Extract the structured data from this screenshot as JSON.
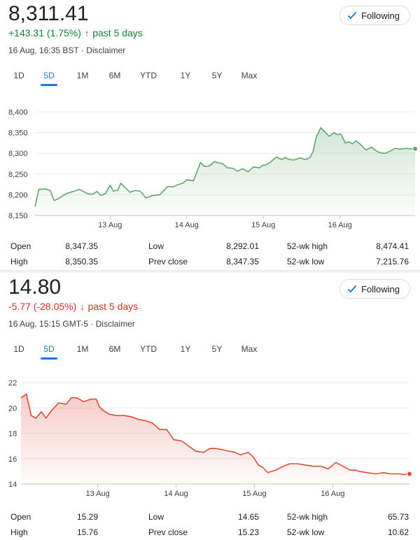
{
  "cards": [
    {
      "price": "8,311.41",
      "change_text": "+143.31 (1.75%)",
      "change_arrow": "↑",
      "change_period": "past 5 days",
      "timestamp": "16 Aug, 16:35 BST · Disclaimer",
      "trend": "up",
      "follow_label": "Following",
      "tabs": [
        "1D",
        "5D",
        "1M",
        "6M",
        "YTD",
        "1Y",
        "5Y",
        "Max"
      ],
      "active_tab": "5D",
      "stats": {
        "open": {
          "label": "Open",
          "value": "8,347.35"
        },
        "high": {
          "label": "High",
          "value": "8,350.35"
        },
        "low": {
          "label": "Low",
          "value": "8,292.01"
        },
        "prev_close": {
          "label": "Prev close",
          "value": "8,347.35"
        },
        "wk52_high": {
          "label": "52-wk high",
          "value": "8,474.41"
        },
        "wk52_low": {
          "label": "52-wk low",
          "value": "7,215.76"
        }
      }
    },
    {
      "price": "14.80",
      "change_text": "-5.77 (-28.05%)",
      "change_arrow": "↓",
      "change_period": "past 5 days",
      "timestamp": "16 Aug, 15:15 GMT-5 · Disclaimer",
      "trend": "down",
      "follow_label": "Following",
      "tabs": [
        "1D",
        "5D",
        "1M",
        "6M",
        "YTD",
        "1Y",
        "5Y",
        "Max"
      ],
      "active_tab": "5D",
      "stats": {
        "open": {
          "label": "Open",
          "value": "15.29"
        },
        "high": {
          "label": "High",
          "value": "15.76"
        },
        "low": {
          "label": "Low",
          "value": "14.65"
        },
        "prev_close": {
          "label": "Prev close",
          "value": "15.23"
        },
        "wk52_high": {
          "label": "52-wk high",
          "value": "65.73"
        },
        "wk52_low": {
          "label": "52-wk low",
          "value": "10.62"
        }
      }
    }
  ],
  "colors": {
    "up": "#188038",
    "up_line": "#5fa86a",
    "down": "#d93025",
    "down_line": "#dd4b39",
    "accent": "#1a73e8"
  },
  "chart_data": [
    {
      "type": "area",
      "y_ticks": [
        "8,400",
        "8,350",
        "8,300",
        "8,250",
        "8,200",
        "8,150"
      ],
      "y_tick_values": [
        8400,
        8350,
        8300,
        8250,
        8200,
        8150
      ],
      "ylim": [
        8150,
        8400
      ],
      "x_ticks": [
        {
          "label": "13 Aug",
          "x": 1
        },
        {
          "label": "14 Aug",
          "x": 2
        },
        {
          "label": "15 Aug",
          "x": 3
        },
        {
          "label": "16 Aug",
          "x": 4
        }
      ],
      "xlim": [
        0.02,
        4.98
      ],
      "grid": true,
      "x": [
        0.02,
        0.07,
        0.16,
        0.22,
        0.27,
        0.34,
        0.43,
        0.52,
        0.6,
        0.7,
        0.77,
        0.83,
        0.88,
        0.94,
        1.0,
        1.04,
        1.1,
        1.14,
        1.19,
        1.26,
        1.32,
        1.39,
        1.47,
        1.55,
        1.65,
        1.75,
        1.82,
        1.88,
        1.95,
        2.0,
        2.09,
        2.18,
        2.23,
        2.3,
        2.36,
        2.42,
        2.47,
        2.53,
        2.6,
        2.66,
        2.73,
        2.8,
        2.87,
        2.95,
        2.99,
        3.03,
        3.09,
        3.17,
        3.24,
        3.28,
        3.34,
        3.4,
        3.48,
        3.55,
        3.61,
        3.65,
        3.69,
        3.75,
        3.8,
        3.86,
        3.92,
        3.97,
        4.01,
        4.07,
        4.12,
        4.16,
        4.21,
        4.27,
        4.34,
        4.41,
        4.48,
        4.53,
        4.59,
        4.65,
        4.72,
        4.79,
        4.86,
        4.92,
        4.98
      ],
      "y": [
        8171,
        8213,
        8214,
        8210,
        8186,
        8192,
        8203,
        8208,
        8213,
        8203,
        8201,
        8208,
        8198,
        8203,
        8223,
        8209,
        8211,
        8228,
        8218,
        8206,
        8210,
        8209,
        8192,
        8198,
        8200,
        8220,
        8219,
        8224,
        8228,
        8236,
        8234,
        8278,
        8268,
        8270,
        8280,
        8277,
        8275,
        8265,
        8264,
        8257,
        8263,
        8255,
        8267,
        8265,
        8271,
        8272,
        8278,
        8291,
        8285,
        8290,
        8285,
        8284,
        8289,
        8285,
        8290,
        8305,
        8339,
        8362,
        8352,
        8341,
        8350,
        8345,
        8347,
        8325,
        8328,
        8323,
        8330,
        8321,
        8308,
        8315,
        8305,
        8301,
        8300,
        8305,
        8312,
        8310,
        8312,
        8311,
        8311
      ]
    },
    {
      "type": "area",
      "y_ticks": [
        "22",
        "20",
        "18",
        "16",
        "14"
      ],
      "y_tick_values": [
        22,
        20,
        18,
        16,
        14
      ],
      "ylim": [
        14,
        22
      ],
      "x_ticks": [
        {
          "label": "13 Aug",
          "x": 1
        },
        {
          "label": "14 Aug",
          "x": 2
        },
        {
          "label": "15 Aug",
          "x": 3
        },
        {
          "label": "16 Aug",
          "x": 4
        }
      ],
      "xlim": [
        0.02,
        4.98
      ],
      "grid": true,
      "x": [
        0.02,
        0.09,
        0.15,
        0.21,
        0.28,
        0.34,
        0.41,
        0.5,
        0.6,
        0.66,
        0.73,
        0.82,
        0.91,
        0.98,
        1.02,
        1.07,
        1.15,
        1.24,
        1.34,
        1.43,
        1.52,
        1.61,
        1.7,
        1.79,
        1.88,
        1.97,
        2.07,
        2.16,
        2.25,
        2.35,
        2.43,
        2.51,
        2.6,
        2.67,
        2.75,
        2.82,
        2.92,
        2.99,
        3.05,
        3.11,
        3.17,
        3.27,
        3.37,
        3.45,
        3.55,
        3.65,
        3.75,
        3.85,
        3.94,
        4.04,
        4.13,
        4.22,
        4.29,
        4.34,
        4.44,
        4.55,
        4.65,
        4.74,
        4.85,
        4.91,
        4.98
      ],
      "y": [
        20.8,
        21.1,
        19.4,
        19.2,
        19.7,
        19.2,
        19.8,
        20.4,
        20.3,
        20.8,
        20.8,
        20.5,
        20.7,
        20.7,
        20.1,
        19.8,
        19.5,
        19.4,
        19.4,
        19.3,
        19.1,
        19.0,
        18.8,
        18.3,
        18.3,
        17.5,
        17.4,
        17.0,
        16.6,
        16.5,
        16.8,
        16.8,
        16.7,
        16.6,
        16.5,
        16.3,
        16.5,
        16.1,
        15.5,
        15.3,
        14.9,
        15.1,
        15.4,
        15.6,
        15.6,
        15.5,
        15.4,
        15.4,
        15.2,
        15.7,
        15.4,
        15.1,
        15.1,
        15.0,
        14.9,
        14.8,
        14.9,
        14.8,
        14.8,
        14.75,
        14.8
      ]
    }
  ]
}
